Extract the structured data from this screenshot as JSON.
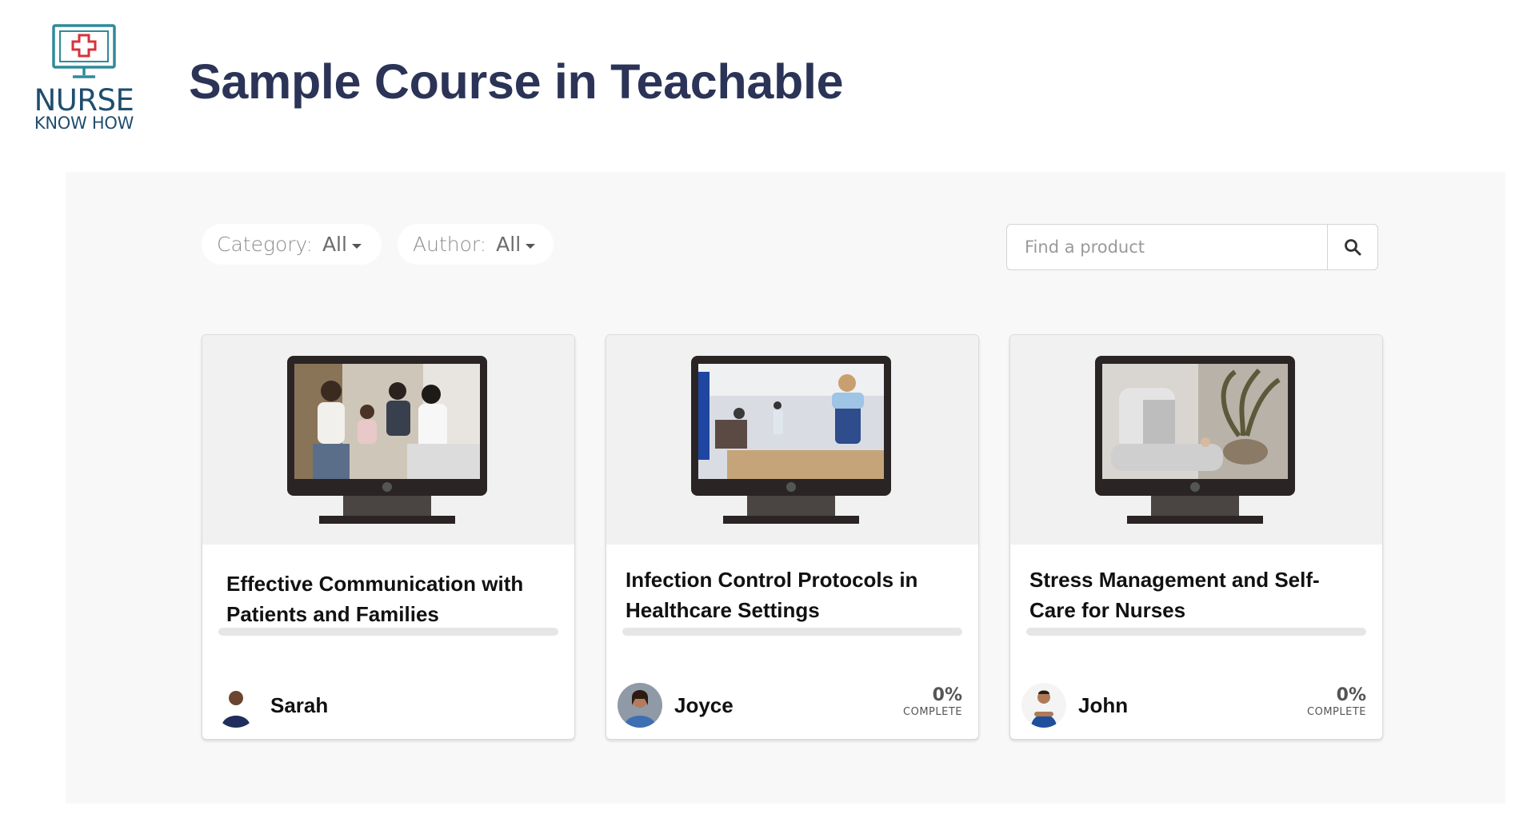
{
  "header": {
    "logo": {
      "line1": "NURSE",
      "line2": "KNOW HOW"
    },
    "title": "Sample Course in Teachable"
  },
  "filters": {
    "category": {
      "label": "Category:",
      "value": "All"
    },
    "author": {
      "label": "Author:",
      "value": "All"
    }
  },
  "search": {
    "placeholder": "Find a product"
  },
  "courses": [
    {
      "title": "Effective Communication with Patients and Families",
      "author": "Sarah",
      "progress": 0,
      "complete_percent": "",
      "complete_label": ""
    },
    {
      "title": "Infection Control Protocols in Healthcare Settings",
      "author": "Joyce",
      "progress": 0,
      "complete_percent": "0%",
      "complete_label": "COMPLETE"
    },
    {
      "title": "Stress Management and Self-Care for Nurses",
      "author": "John",
      "progress": 0,
      "complete_percent": "0%",
      "complete_label": "COMPLETE"
    }
  ],
  "colors": {
    "title": "#2b3457",
    "logo_teal": "#2f8a9c",
    "logo_red": "#d6323c",
    "panel_bg": "#f8f8f8",
    "monitor": "#2a2524"
  },
  "icons": {
    "search": "search-icon",
    "caret": "caret-down-icon"
  }
}
